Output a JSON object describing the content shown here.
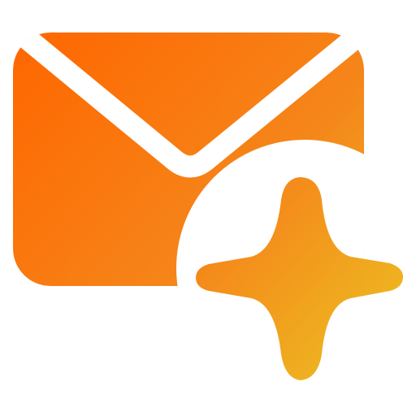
{
  "icon": {
    "name": "mail-sparkle",
    "colors": {
      "gradient_start": "#ff6600",
      "gradient_mid": "#f5861a",
      "gradient_end": "#ecc322",
      "cutout": "#ffffff"
    }
  }
}
